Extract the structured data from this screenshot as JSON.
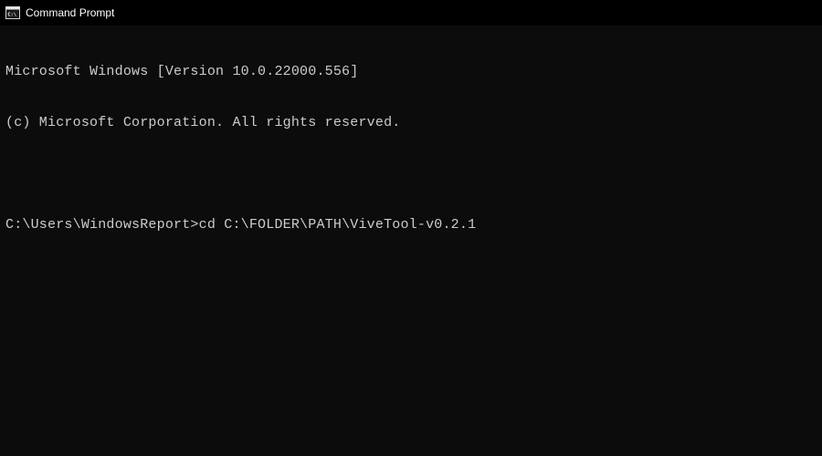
{
  "titlebar": {
    "title": "Command Prompt"
  },
  "terminal": {
    "line1": "Microsoft Windows [Version 10.0.22000.556]",
    "line2": "(c) Microsoft Corporation. All rights reserved.",
    "line3": "",
    "prompt": "C:\\Users\\WindowsReport>",
    "command": "cd C:\\FOLDER\\PATH\\ViveTool-v0.2.1"
  }
}
